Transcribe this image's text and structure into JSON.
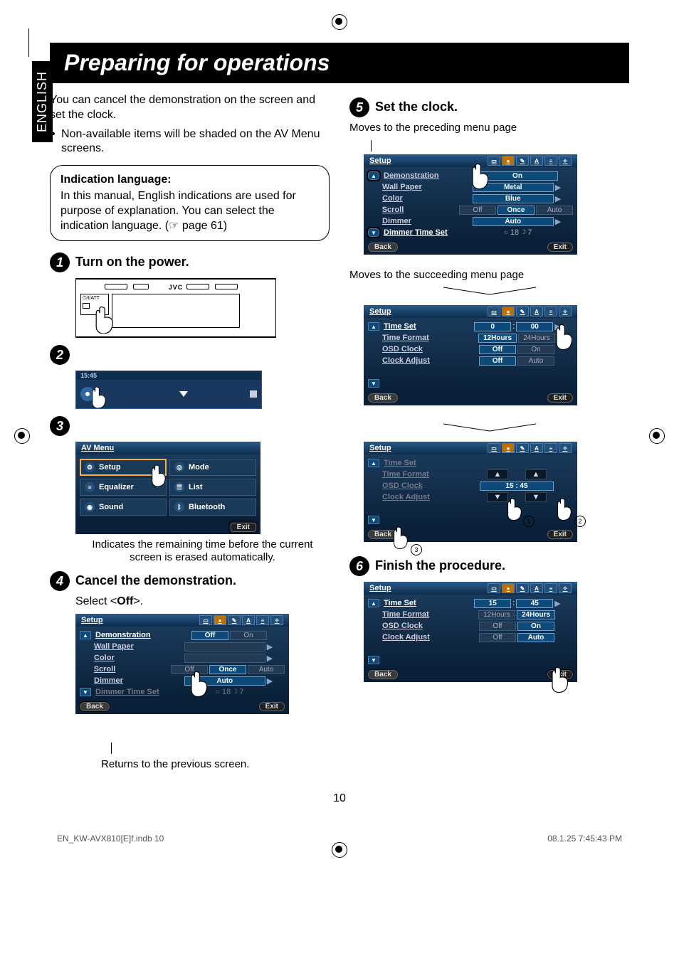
{
  "language_tab": "ENGLISH",
  "title": "Preparing for operations",
  "intro_text": "You can cancel the demonstration on the screen and set the clock.",
  "intro_bullet": "Non-available items will be shaded on the AV Menu screens.",
  "callout": {
    "title": "Indication language:",
    "body_a": "In this manual, English indications are used for purpose of explanation. You can select the indication language. (",
    "body_ref": "☞ page 61",
    "body_b": ")"
  },
  "steps": {
    "s1": {
      "num": "1",
      "heading": "Turn on the power."
    },
    "s2": {
      "num": "2"
    },
    "s3": {
      "num": "3"
    },
    "s4": {
      "num": "4",
      "heading": "Cancel the demonstration.",
      "sub": "Select <Off>."
    },
    "s5": {
      "num": "5",
      "heading": "Set the clock."
    },
    "s6": {
      "num": "6",
      "heading": "Finish the procedure."
    }
  },
  "device": {
    "brand": "JVC",
    "att_label": "⏻/I/ATT"
  },
  "sourcebar": {
    "time": "15:45"
  },
  "avmenu": {
    "title": "AV Menu",
    "items": [
      "Setup",
      "Mode",
      "Equalizer",
      "List",
      "Sound",
      "Bluetooth"
    ],
    "exit": "Exit"
  },
  "caption_avmenu": "Indicates the remaining time before the current screen is erased automatically.",
  "setup_a": {
    "title": "Setup",
    "rows": [
      {
        "label": "Demonstration",
        "opts": [
          "Off",
          "On"
        ],
        "sel": 0
      },
      {
        "label": "Wall Paper",
        "opts": [
          ""
        ],
        "wide": true
      },
      {
        "label": "Color",
        "opts": [
          ""
        ],
        "wide": true
      },
      {
        "label": "Scroll",
        "opts": [
          "Off",
          "Once",
          "Auto"
        ],
        "sel": 1
      },
      {
        "label": "Dimmer",
        "opts": [
          "Auto"
        ],
        "sel": 0,
        "wide": true
      },
      {
        "label": "Dimmer Time Set",
        "opts": [
          "18",
          "7"
        ],
        "dim": true
      }
    ],
    "back": "Back",
    "exit": "Exit"
  },
  "caption_back": "Returns to the previous screen.",
  "caption_prev": "Moves to the preceding menu page",
  "caption_next": "Moves to the succeeding menu page",
  "setup_b": {
    "title": "Setup",
    "rows": [
      {
        "label": "Demonstration",
        "opts": [
          "On"
        ],
        "sel": 0,
        "wide": true
      },
      {
        "label": "Wall Paper",
        "opts": [
          "Metal"
        ],
        "sel": 0,
        "wide": true
      },
      {
        "label": "Color",
        "opts": [
          "Blue"
        ],
        "sel": 0,
        "wide": true
      },
      {
        "label": "Scroll",
        "opts": [
          "Off",
          "Once",
          "Auto"
        ],
        "sel": 1
      },
      {
        "label": "Dimmer",
        "opts": [
          "Auto"
        ],
        "sel": 0,
        "wide": true
      },
      {
        "label": "Dimmer Time Set",
        "opts": [
          "18",
          "7"
        ],
        "dim": true,
        "active": true
      }
    ],
    "back": "Back",
    "exit": "Exit"
  },
  "setup_c": {
    "title": "Setup",
    "rows": [
      {
        "label": "Time Set",
        "opts": [
          "0",
          ":",
          "00"
        ],
        "active": true
      },
      {
        "label": "Time Format",
        "opts": [
          "12Hours",
          "24Hours"
        ],
        "sel": 0
      },
      {
        "label": "OSD Clock",
        "opts": [
          "Off",
          "On"
        ],
        "sel": 0
      },
      {
        "label": "Clock Adjust",
        "opts": [
          "Off",
          "Auto"
        ],
        "sel": 0
      }
    ],
    "back": "Back",
    "exit": "Exit"
  },
  "setup_d": {
    "title": "Setup",
    "rows": [
      {
        "label": "Time Set"
      },
      {
        "label": "Time Format"
      },
      {
        "label": "OSD Clock",
        "arrows": true,
        "center": "15 : 45"
      },
      {
        "label": "Clock Adjust"
      }
    ],
    "back": "Back",
    "exit": "Exit",
    "annos": [
      "1",
      "2",
      "3"
    ]
  },
  "setup_e": {
    "title": "Setup",
    "rows": [
      {
        "label": "Time Set",
        "opts": [
          "15",
          ":",
          "45"
        ],
        "active": true
      },
      {
        "label": "Time Format",
        "opts": [
          "12Hours",
          "24Hours"
        ],
        "sel": 1
      },
      {
        "label": "OSD Clock",
        "opts": [
          "Off",
          "On"
        ],
        "sel": 1
      },
      {
        "label": "Clock Adjust",
        "opts": [
          "Off",
          "Auto"
        ],
        "sel": 1
      }
    ],
    "back": "Back",
    "exit": "Exit"
  },
  "page_number": "10",
  "footer_left": "EN_KW-AVX810[E]f.indb   10",
  "footer_right": "08.1.25   7:45:43 PM"
}
